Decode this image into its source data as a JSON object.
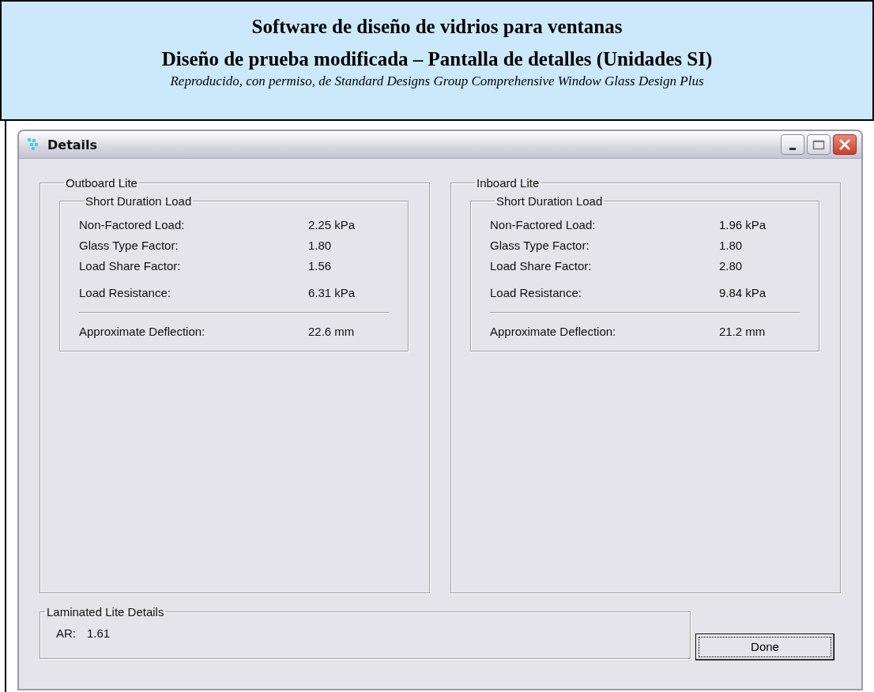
{
  "header": {
    "title": "Software de diseño de vidrios para ventanas",
    "subtitle": "Diseño de prueba modificada – Pantalla de detalles (Unidades SI)",
    "credit": "Reproducido, con permiso, de Standard Designs Group Comprehensive Window Glass Design Plus"
  },
  "window": {
    "title": "Details"
  },
  "lites": [
    {
      "title": "Outboard Lite",
      "group": "Short Duration Load",
      "rows": [
        {
          "kind": "plain",
          "label": "Non-Factored Load:",
          "value": "2.25 kPa"
        },
        {
          "kind": "plain",
          "label": "Glass Type Factor:",
          "value": "1.80"
        },
        {
          "kind": "plain",
          "label": "Load Share Factor:",
          "value": "1.56"
        },
        {
          "kind": "spaced",
          "label": "Load Resistance:",
          "value": "6.31 kPa"
        },
        {
          "kind": "divided",
          "label": "Approximate Deflection:",
          "value": "22.6 mm"
        }
      ]
    },
    {
      "title": "Inboard Lite",
      "group": "Short Duration Load",
      "rows": [
        {
          "kind": "plain",
          "label": "Non-Factored Load:",
          "value": "1.96 kPa"
        },
        {
          "kind": "plain",
          "label": "Glass Type Factor:",
          "value": "1.80"
        },
        {
          "kind": "plain",
          "label": "Load Share Factor:",
          "value": "2.80"
        },
        {
          "kind": "spaced",
          "label": "Load Resistance:",
          "value": "9.84 kPa"
        },
        {
          "kind": "divided",
          "label": "Approximate Deflection:",
          "value": "21.2 mm"
        }
      ]
    }
  ],
  "laminated": {
    "title": "Laminated Lite Details",
    "label": "AR:",
    "value": "1.61"
  },
  "done_button": {
    "label": "Done"
  }
}
